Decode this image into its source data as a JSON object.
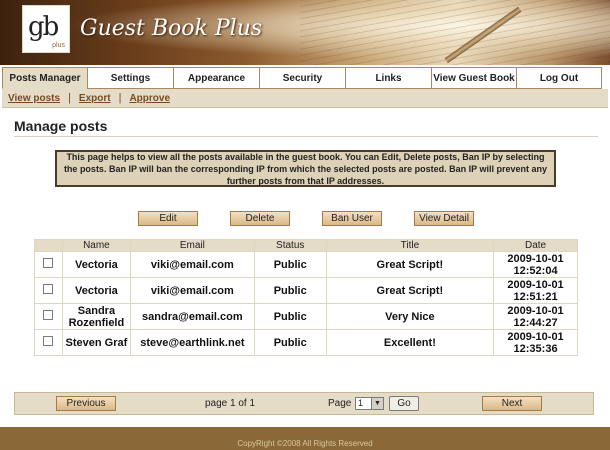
{
  "brand": {
    "logo_text": "gb",
    "logo_sub": "plus",
    "title": "Guest Book Plus"
  },
  "tabs": [
    {
      "label": "Posts Manager"
    },
    {
      "label": "Settings"
    },
    {
      "label": "Appearance"
    },
    {
      "label": "Security"
    },
    {
      "label": "Links"
    },
    {
      "label": "View Guest Book"
    },
    {
      "label": "Log Out"
    }
  ],
  "subnav": {
    "view_posts": "View posts",
    "export": "Export",
    "approve": "Approve",
    "separator": "|"
  },
  "page": {
    "title": "Manage posts",
    "info": "This page helps to view all the posts available in the guest book. You can Edit, Delete posts, Ban IP by selecting the posts. Ban IP will ban the corresponding IP from which the selected posts are posted. Ban IP will prevent any further posts from that IP addresses."
  },
  "actions": {
    "edit": "Edit",
    "delete": "Delete",
    "ban_user": "Ban User",
    "view_detail": "View Detail"
  },
  "table": {
    "headers": {
      "name": "Name",
      "email": "Email",
      "status": "Status",
      "title": "Title",
      "date": "Date"
    },
    "rows": [
      {
        "name": "Vectoria",
        "email": "viki@email.com",
        "status": "Public",
        "title": "Great Script!",
        "date": "2009-10-01",
        "time": "12:52:04"
      },
      {
        "name": "Vectoria",
        "email": "viki@email.com",
        "status": "Public",
        "title": "Great Script!",
        "date": "2009-10-01",
        "time": "12:51:21"
      },
      {
        "name": "Sandra Rozenfield",
        "email": "sandra@email.com",
        "status": "Public",
        "title": "Very Nice",
        "date": "2009-10-01",
        "time": "12:44:27"
      },
      {
        "name": "Steven Graf",
        "email": "steve@earthlink.net",
        "status": "Public",
        "title": "Excellent!",
        "date": "2009-10-01",
        "time": "12:35:36"
      }
    ]
  },
  "pager": {
    "previous": "Previous",
    "page_info": "page 1 of 1",
    "page_label": "Page",
    "selected_page": "1",
    "go": "Go",
    "next": "Next"
  },
  "footer": {
    "copyright": "CopyRight ©2008 All Rights Reserved"
  },
  "colors": {
    "accent": "#e5dcc8",
    "brand_brown": "#8a6838",
    "link": "#7a4a1e"
  }
}
